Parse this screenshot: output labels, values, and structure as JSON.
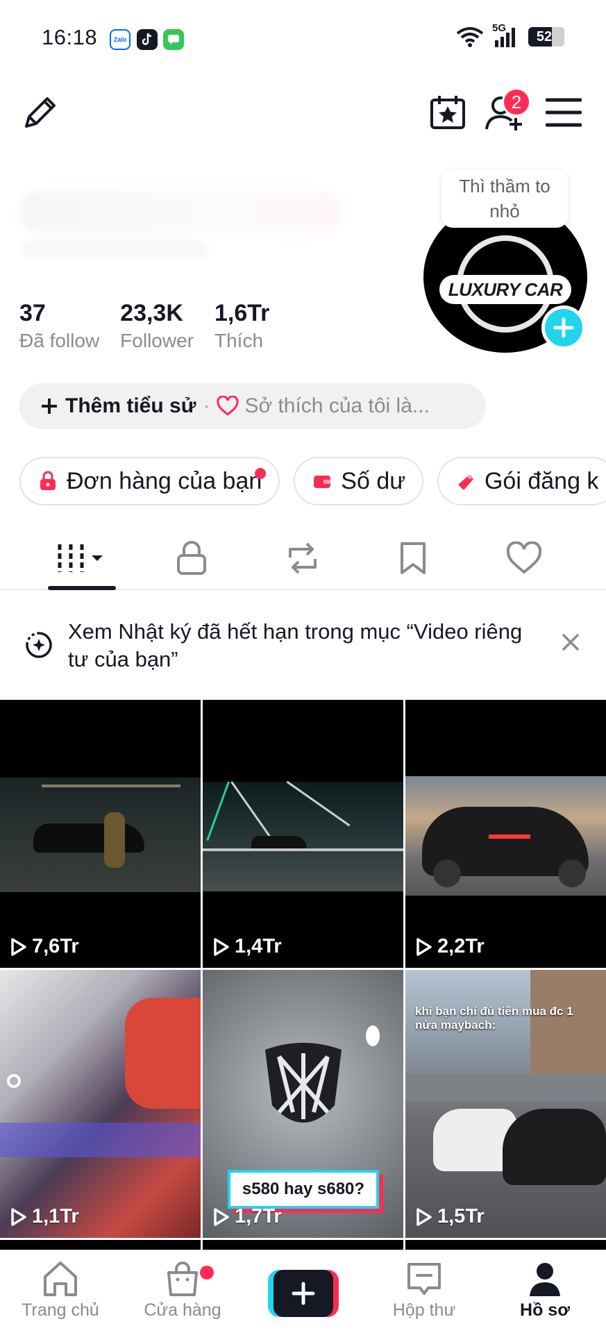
{
  "status_bar": {
    "time": "16:18",
    "apps": [
      "Zalo",
      "TikTok",
      "Messages"
    ],
    "zalo_label": "Zalo",
    "network": "5G",
    "battery": "52"
  },
  "header": {
    "friend_badge_count": "2",
    "icons": [
      "edit-icon",
      "calendar-star-icon",
      "add-friend-icon",
      "menu-icon"
    ]
  },
  "profile": {
    "tooltip": "Thì thầm to nhỏ",
    "avatar_logo_text": "LUXURY CAR",
    "stats": [
      {
        "value": "37",
        "label": "Đã follow"
      },
      {
        "value": "23,3K",
        "label": "Follower"
      },
      {
        "value": "1,6Tr",
        "label": "Thích"
      }
    ],
    "bio_add": "Thêm tiểu sử",
    "bio_separator": "·",
    "hobby": "Sở thích của tôi là..."
  },
  "chips": [
    {
      "label": "Đơn hàng của bạn",
      "has_dot": true
    },
    {
      "label": "Số dư",
      "has_dot": false
    },
    {
      "label": "Gói đăng k",
      "has_dot": false
    }
  ],
  "tabs": [
    "videos",
    "private",
    "reposts",
    "favorites",
    "liked"
  ],
  "notice": {
    "text": "Xem Nhật ký đã hết hạn trong mục “Video riêng tư của bạn”"
  },
  "videos": [
    {
      "views": "7,6Tr"
    },
    {
      "views": "1,4Tr"
    },
    {
      "views": "2,2Tr"
    },
    {
      "views": "1,1Tr"
    },
    {
      "views": "1,7Tr",
      "caption": "s580 hay s680?"
    },
    {
      "views": "1,5Tr",
      "caption": "khi bạn chỉ đủ tiền mua đc 1 nửa maybach:"
    }
  ],
  "bottom_nav": {
    "home": "Trang chủ",
    "shop": "Cửa hàng",
    "inbox": "Hộp thư",
    "profile": "Hồ sơ"
  },
  "colors": {
    "accent_red": "#fe2c55",
    "accent_cyan": "#20d5ec",
    "text_primary": "#161823",
    "text_secondary": "#8a8b91"
  }
}
